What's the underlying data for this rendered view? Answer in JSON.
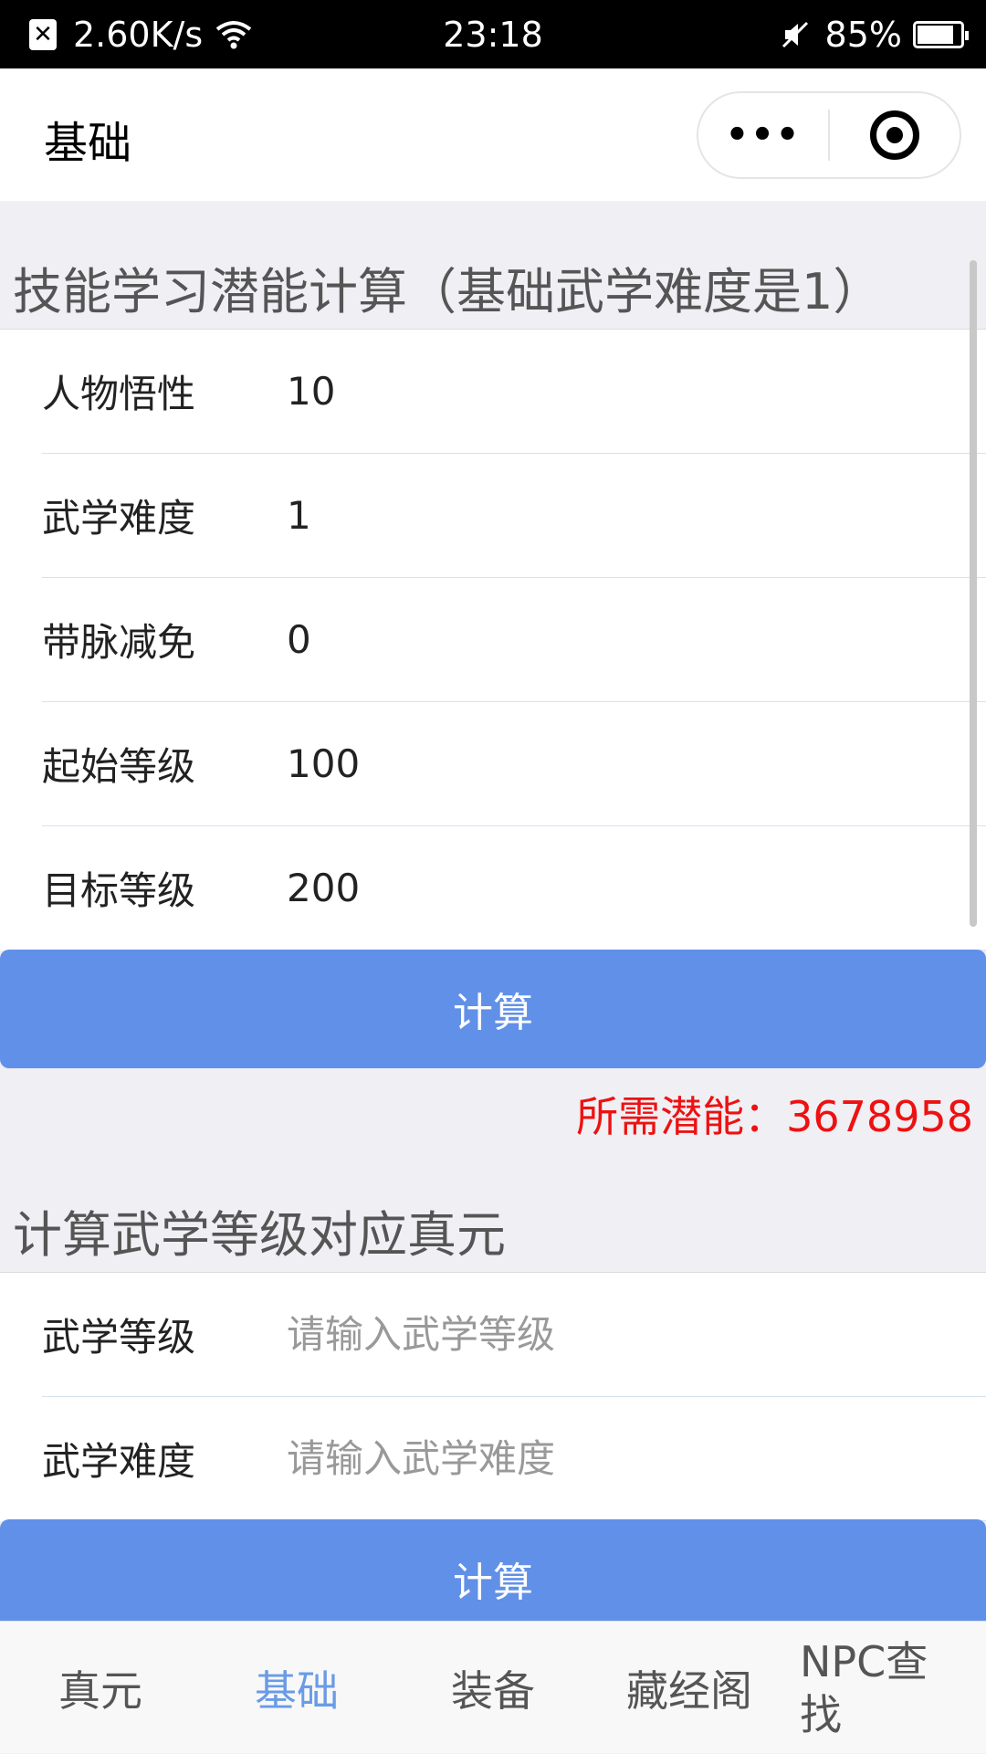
{
  "status_bar": {
    "close_glyph": "✕",
    "net_speed": "2.60K/s",
    "time": "23:18",
    "battery": "85%",
    "battery_level": 0.85
  },
  "nav": {
    "title": "基础",
    "more_glyph": "•••"
  },
  "section1": {
    "title": "技能学习潜能计算（基础武学难度是1）",
    "rows": [
      {
        "label": "人物悟性",
        "value": "10"
      },
      {
        "label": "武学难度",
        "value": "1"
      },
      {
        "label": "带脉减免",
        "value": "0"
      },
      {
        "label": "起始等级",
        "value": "100"
      },
      {
        "label": "目标等级",
        "value": "200"
      }
    ],
    "button": "计算",
    "result": "所需潜能：3678958"
  },
  "section2": {
    "title": "计算武学等级对应真元",
    "rows": [
      {
        "label": "武学等级",
        "placeholder": "请输入武学等级"
      },
      {
        "label": "武学难度",
        "placeholder": "请输入武学难度"
      }
    ],
    "button": "计算"
  },
  "tabs": [
    {
      "label": "真元",
      "active": false
    },
    {
      "label": "基础",
      "active": true
    },
    {
      "label": "装备",
      "active": false
    },
    {
      "label": "藏经阁",
      "active": false
    },
    {
      "label": "NPC查找",
      "active": false
    }
  ],
  "colors": {
    "button": "#6190e8",
    "result": "#ee1111",
    "tab_active": "#6a9be6"
  }
}
